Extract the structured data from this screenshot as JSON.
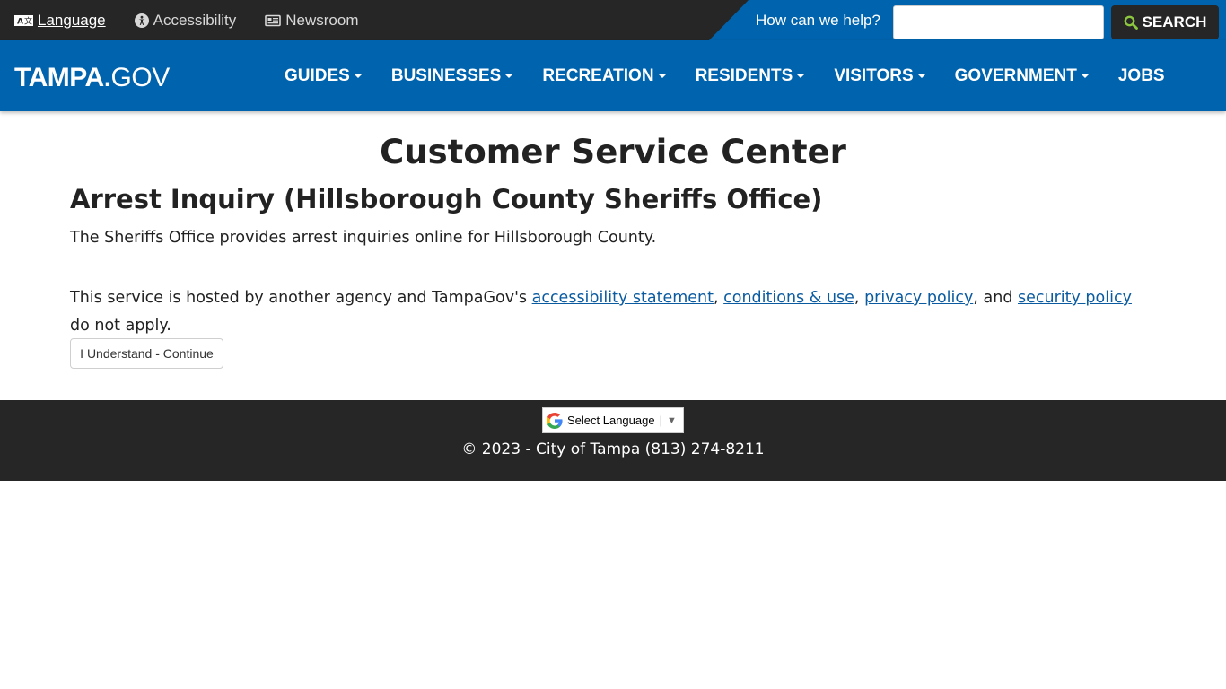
{
  "utility": {
    "language": "Language",
    "accessibility": "Accessibility",
    "newsroom": "Newsroom",
    "search_label": "How can we help?",
    "search_value": "",
    "search_button": "SEARCH"
  },
  "logo": {
    "part1": "TAMPA.",
    "part2": "GOV"
  },
  "nav": {
    "items": [
      "GUIDES",
      "BUSINESSES",
      "RECREATION",
      "RESIDENTS",
      "VISITORS",
      "GOVERNMENT",
      "JOBS"
    ]
  },
  "content": {
    "title": "Customer Service Center",
    "subtitle": "Arrest Inquiry (Hillsborough County Sheriffs Office)",
    "description": "The Sheriffs Office provides arrest inquiries online for Hillsborough County.",
    "notice_prefix": "This service is hosted by another agency and TampaGov's ",
    "link_accessibility": "accessibility statement",
    "sep1": ", ",
    "link_conditions": "conditions & use",
    "sep2": ", ",
    "link_privacy": "privacy policy",
    "sep3": ", and ",
    "link_security": "security policy",
    "notice_suffix": " do not apply.",
    "continue_button": "I Understand - Continue"
  },
  "footer": {
    "select_language": "Select Language",
    "copyright": "© 2023 - City of Tampa (813) 274-8211"
  },
  "colors": {
    "brand_blue": "#0063ad",
    "dark_bar": "#262626",
    "link": "#0b5ba1"
  }
}
